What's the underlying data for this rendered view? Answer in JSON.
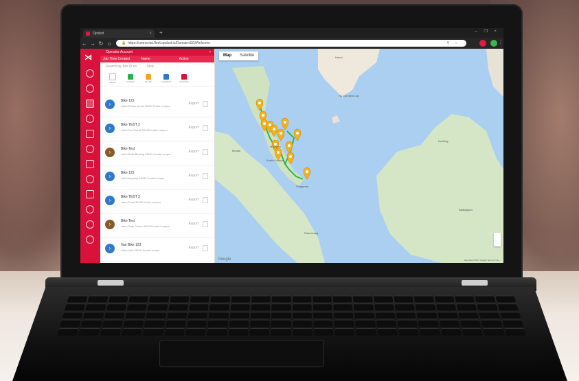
{
  "browser": {
    "tab_title": "Opsbot",
    "tab_close": "×",
    "new_tab": "+",
    "window_controls": "– ❐ ×",
    "url": "https://connectet.fleet.opsbot.io/DomainsSG/Welcome",
    "menu": "⋮"
  },
  "app": {
    "panel": {
      "title": "Operator Account",
      "close": "×",
      "columns": [
        "Job Time Created",
        "Name",
        "Action"
      ],
      "search_placeholder": "Search by Job ID no",
      "search_mid": "Stop"
    },
    "rows": [
      {
        "name": "Bike 123",
        "sub": "Jalan Sultan Ismail 50250 Kuala Lumpur",
        "action": "Export",
        "color": "#2f79c8"
      },
      {
        "name": "Bike TEST 2",
        "sub": "Jalan Tun Razak 50400 Kuala Lumpur",
        "action": "Export",
        "color": "#2f79c8"
      },
      {
        "name": "Bike Test",
        "sub": "Jalan Bukit Bintang 55100 Kuala Lumpur",
        "action": "Export",
        "color": "#8a5a2b"
      },
      {
        "name": "Bike 123",
        "sub": "Jalan Ampang 50450 Kuala Lumpur",
        "action": "Export",
        "color": "#2f79c8"
      },
      {
        "name": "Bike TEST 2",
        "sub": "Jalan Pudu 55100 Kuala Lumpur",
        "action": "Export",
        "color": "#2f79c8"
      },
      {
        "name": "Bike Test",
        "sub": "Jalan Raja Chulan 50200 Kuala Lumpur",
        "action": "Export",
        "color": "#8a5a2b"
      },
      {
        "name": "Van Bike 123",
        "sub": "Jalan Imbi 55100 Kuala Lumpur",
        "action": "Export",
        "color": "#2f79c8"
      }
    ],
    "filter_labels": [
      "All Job",
      "Assigned",
      "On Job",
      "Completed",
      "Reviewed"
    ],
    "filter_colors": [
      "#ffffff",
      "#2fae4f",
      "#f3a521",
      "#2f79c8",
      "#d9123b"
    ]
  },
  "map": {
    "tab_map": "Map",
    "tab_satellite": "Satellite",
    "labels": [
      "Hanoi",
      "Ho Chi Minh City",
      "Malaysia",
      "Kuala Lumpur",
      "Singapore",
      "Kuching",
      "Palembang",
      "Balikpapan",
      "Medan"
    ],
    "google": "Google",
    "terms": "Map data ©2017 Google Terms of Use",
    "marker_count": 13,
    "marker_color": "#f3b21d",
    "route_color": "#35b34a"
  }
}
